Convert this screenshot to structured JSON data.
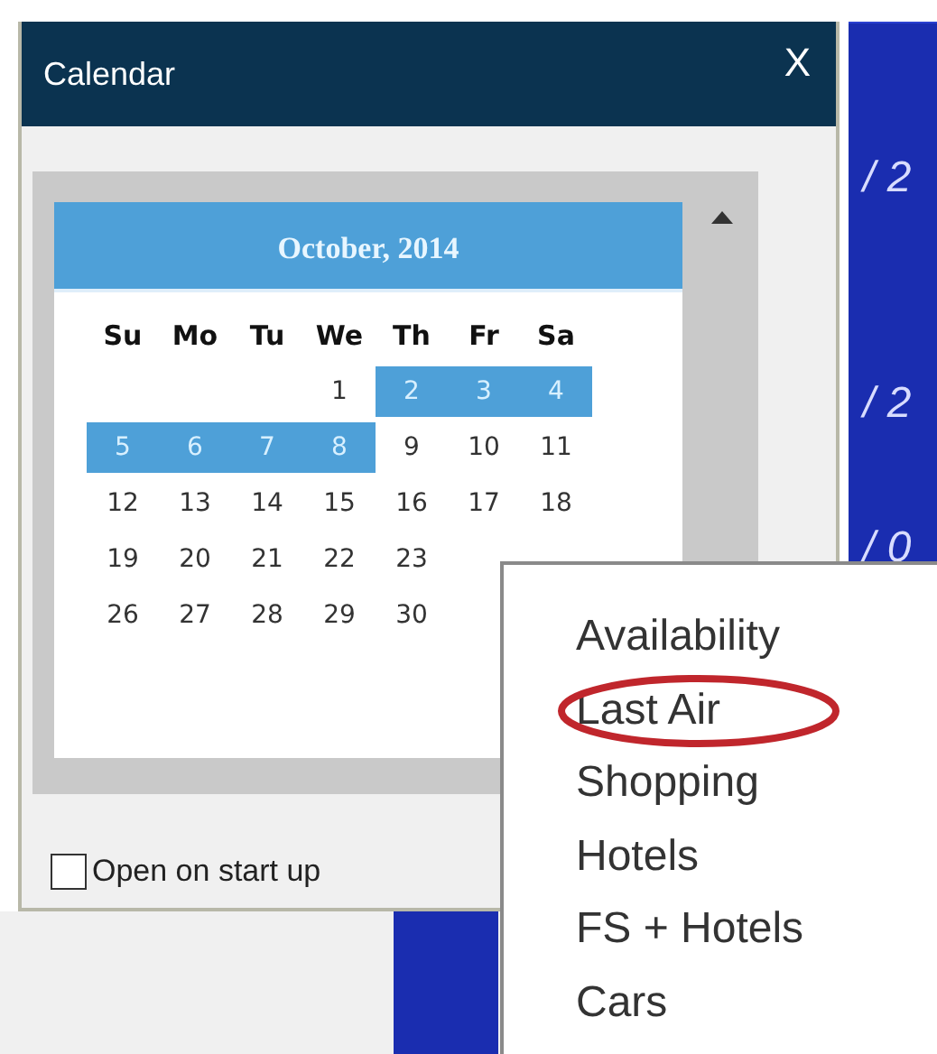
{
  "window": {
    "title": "Calendar",
    "close": "X"
  },
  "calendar": {
    "month": "October, 2014",
    "weekdays": [
      "Su",
      "Mo",
      "Tu",
      "We",
      "Th",
      "Fr",
      "Sa"
    ],
    "weeks": [
      [
        {
          "kind": "blank"
        },
        {
          "kind": "blank"
        },
        {
          "kind": "blank"
        },
        {
          "day": "1",
          "selected": false
        },
        {
          "day": "2",
          "selected": true
        },
        {
          "day": "3",
          "selected": true
        },
        {
          "day": "4",
          "selected": true
        }
      ],
      [
        {
          "day": "5",
          "selected": true
        },
        {
          "day": "6",
          "selected": true
        },
        {
          "day": "7",
          "selected": true
        },
        {
          "day": "8",
          "selected": true
        },
        {
          "day": "9",
          "selected": false
        },
        {
          "day": "10",
          "selected": false
        },
        {
          "day": "11",
          "selected": false
        }
      ],
      [
        {
          "day": "12",
          "selected": false
        },
        {
          "day": "13",
          "selected": false
        },
        {
          "day": "14",
          "selected": false
        },
        {
          "day": "15",
          "selected": false
        },
        {
          "day": "16",
          "selected": false
        },
        {
          "day": "17",
          "selected": false
        },
        {
          "day": "18",
          "selected": false
        }
      ],
      [
        {
          "day": "19",
          "selected": false
        },
        {
          "day": "20",
          "selected": false
        },
        {
          "day": "21",
          "selected": false
        },
        {
          "day": "22",
          "selected": false
        },
        {
          "day": "23",
          "selected": false
        }
      ],
      [
        {
          "day": "26",
          "selected": false
        },
        {
          "day": "27",
          "selected": false
        },
        {
          "day": "28",
          "selected": false
        },
        {
          "day": "29",
          "selected": false
        },
        {
          "day": "30",
          "selected": false
        }
      ]
    ]
  },
  "open_on_startup": {
    "label": "Open on start up",
    "checked": false
  },
  "background_panel": {
    "rows": [
      "/ 2",
      "/ 2",
      "/ 0"
    ]
  },
  "context_menu": [
    {
      "label": "Availability",
      "circled": false
    },
    {
      "label": "Last Air",
      "circled": true
    },
    {
      "label": "Shopping",
      "circled": false
    },
    {
      "label": "Hotels",
      "circled": false
    },
    {
      "label": "FS + Hotels",
      "circled": false
    },
    {
      "label": "Cars",
      "circled": false
    }
  ]
}
